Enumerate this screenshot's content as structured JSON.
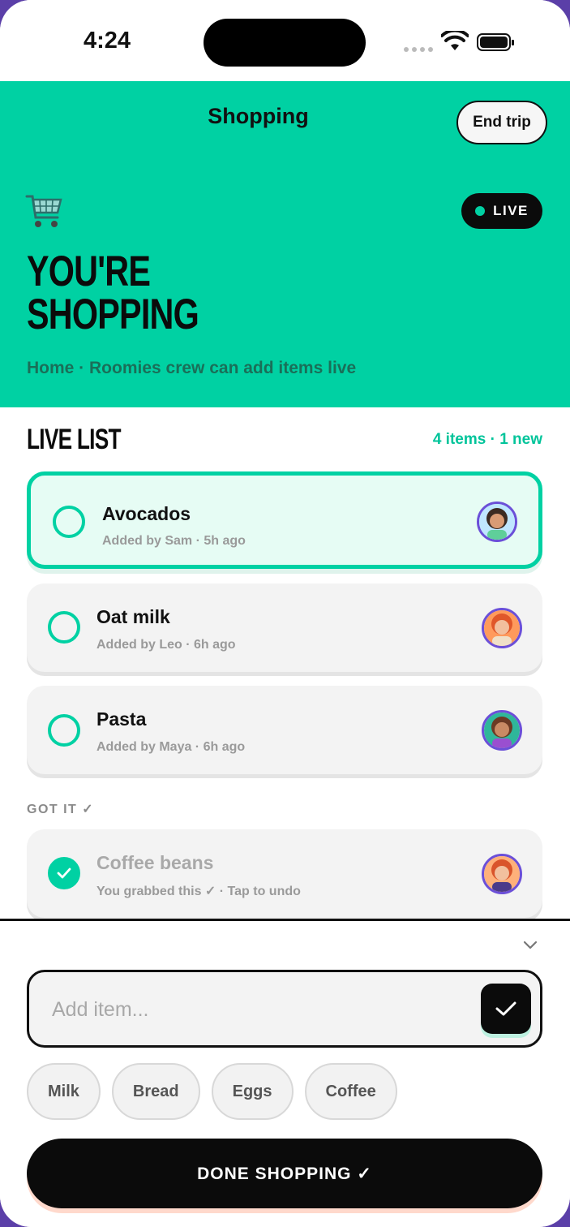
{
  "status_bar": {
    "time": "4:24"
  },
  "header": {
    "title": "Shopping",
    "end_trip_label": "End trip"
  },
  "hero": {
    "live_label": "LIVE",
    "title_line1": "YOU'RE",
    "title_line2": "SHOPPING",
    "subtitle": "Home · Roomies crew can add items live"
  },
  "list": {
    "title": "LIVE LIST",
    "count_text": "4 items · 1 new",
    "items": [
      {
        "name": "Avocados",
        "meta": "Added by Sam · 5h ago",
        "avatar": "avatar-sam"
      },
      {
        "name": "Oat milk",
        "meta": "Added by Leo · 6h ago",
        "avatar": "avatar-leo"
      },
      {
        "name": "Pasta",
        "meta": "Added by Maya · 6h ago",
        "avatar": "avatar-maya"
      }
    ],
    "got_label": "GOT IT ✓",
    "got_items": [
      {
        "name": "Coffee beans",
        "meta": "You grabbed this ✓ · Tap to undo",
        "avatar": "avatar-you"
      }
    ]
  },
  "sheet": {
    "input_placeholder": "Add item...",
    "input_value": "",
    "chips": [
      "Milk",
      "Bread",
      "Eggs",
      "Coffee"
    ],
    "done_label": "DONE SHOPPING ✓"
  },
  "colors": {
    "accent": "#00d1a3",
    "dark": "#0b0b0b",
    "avatar_ring": "#6b4fd8"
  }
}
